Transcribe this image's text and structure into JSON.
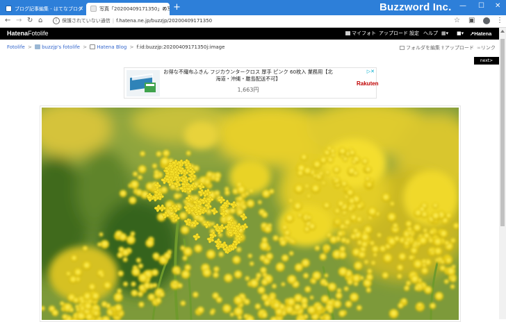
{
  "browser": {
    "tabs": [
      {
        "title": "ブログ記事編集 - はてなブログ",
        "active": false
      },
      {
        "title": "写真「20200409171350」の写真",
        "active": true
      }
    ],
    "new_tab_icon": "+",
    "watermark": "Buzzword Inc.",
    "window_controls": {
      "minimize": "—",
      "maximize": "☐",
      "close": "✕"
    },
    "nav": {
      "back": "←",
      "forward": "→",
      "reload": "↻",
      "home": "⌂"
    },
    "address": {
      "security_text": "保護されていない通信",
      "url": "f.hatena.ne.jp/buzzjp/20200409171350"
    },
    "toolbar_icons": [
      "star-icon",
      "extensions-icon",
      "account-avatar",
      "menu-icon"
    ]
  },
  "site_header": {
    "brand_a": "Hatena",
    "brand_b": "Fotolife",
    "menu": [
      {
        "label": "マイフォト",
        "icon": "photo-icon"
      },
      {
        "label": "アップロード"
      },
      {
        "label": "設定"
      },
      {
        "label": "ヘルプ"
      },
      {
        "label": "▾",
        "icon": "apps-grid-icon"
      },
      {
        "label": "▾",
        "icon": "chat-icon"
      }
    ],
    "hatena_logo": "Hatena"
  },
  "breadcrumb": {
    "root": "Fotolife",
    "user": "buzzjp's fotolife",
    "folder": "Hatena Blog",
    "current": "f:id:buzzjp:20200409171350j:image"
  },
  "page_actions": {
    "edit_folder": "フォルダを編集",
    "upload": "アップロード",
    "link": "リンク"
  },
  "next_button": "next>",
  "ad": {
    "title": "お得な不織布ふきん フジカウンタークロス 厚手 ピンク 60枚入 業務用【北海道・沖縄・離島配送不可】",
    "price": "1,663円",
    "brand": "Rakuten",
    "ad_choices_icon": "▷✕"
  },
  "photo": {
    "description_icon": "rapeseed-flower-photo"
  }
}
